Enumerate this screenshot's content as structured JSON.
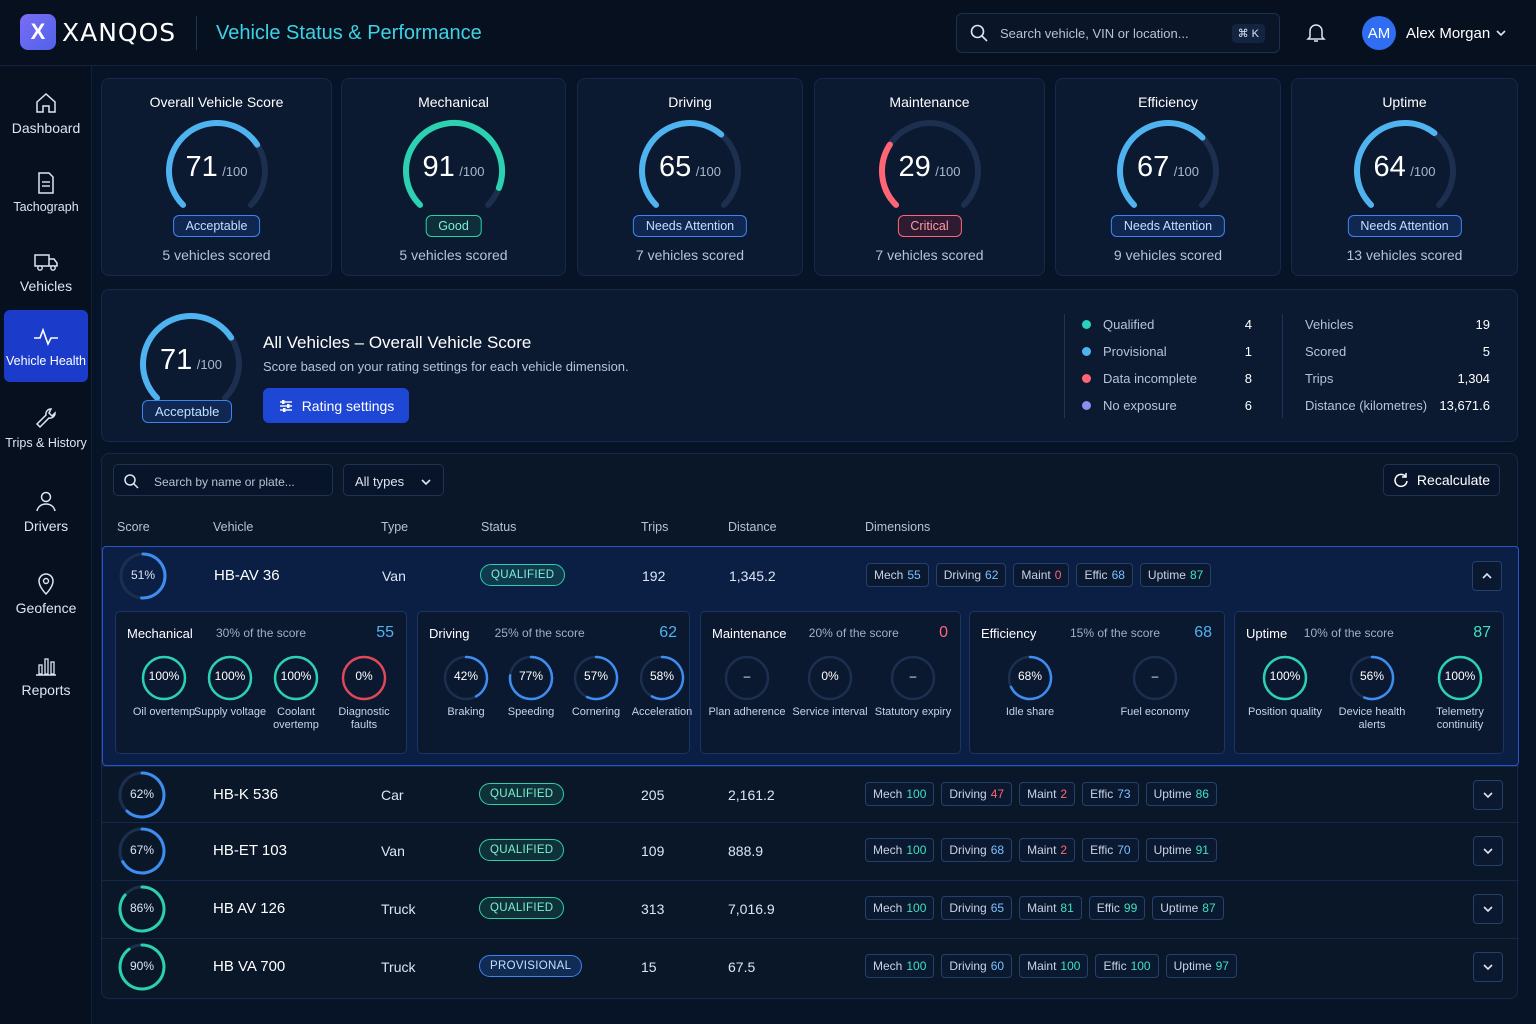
{
  "header": {
    "logo_letter": "X",
    "brand": "XANQOS",
    "title": "Vehicle Status & Performance",
    "search_placeholder": "Search vehicle, VIN or location...",
    "shortcut": "⌘ K",
    "user_initials": "AM",
    "user_name": "Alex Morgan"
  },
  "sidebar": {
    "items": [
      {
        "label": "Dashboard"
      },
      {
        "label": "Tachograph"
      },
      {
        "label": "Vehicles"
      },
      {
        "label": "Vehicle Health"
      },
      {
        "label": "Trips & History"
      },
      {
        "label": "Drivers"
      },
      {
        "label": "Geofence"
      },
      {
        "label": "Reports"
      }
    ]
  },
  "kpis": [
    {
      "title": "Overall Vehicle Score",
      "score": "71",
      "max": "/100",
      "status": "Acceptable",
      "sub": "5 vehicles scored",
      "value": 71
    },
    {
      "title": "Mechanical",
      "score": "91",
      "max": "/100",
      "status": "Good",
      "sub": "5 vehicles scored",
      "value": 91
    },
    {
      "title": "Driving",
      "score": "65",
      "max": "/100",
      "status": "Needs Attention",
      "sub": "7 vehicles scored",
      "value": 65
    },
    {
      "title": "Maintenance",
      "score": "29",
      "max": "/100",
      "status": "Critical",
      "sub": "7 vehicles scored",
      "value": 29
    },
    {
      "title": "Efficiency",
      "score": "67",
      "max": "/100",
      "status": "Needs Attention",
      "sub": "9 vehicles scored",
      "value": 67
    },
    {
      "title": "Uptime",
      "score": "64",
      "max": "/100",
      "status": "Needs Attention",
      "sub": "13 vehicles scored",
      "value": 64
    }
  ],
  "summary": {
    "score": "71",
    "max": "/100",
    "value": 71,
    "status": "Acceptable",
    "title": "All Vehicles – Overall Vehicle Score",
    "desc": "Score based on your rating settings for each vehicle dimension.",
    "button": "Rating settings",
    "legend": [
      {
        "label": "Qualified",
        "value": "4",
        "color": "#2bd1c0"
      },
      {
        "label": "Provisional",
        "value": "1",
        "color": "#4fb3f0"
      },
      {
        "label": "Data incomplete",
        "value": "8",
        "color": "#ff6574"
      },
      {
        "label": "No exposure",
        "value": "6",
        "color": "#8a8ff0"
      }
    ],
    "stats": [
      {
        "label": "Vehicles",
        "value": "19"
      },
      {
        "label": "Scored",
        "value": "5"
      },
      {
        "label": "Trips",
        "value": "1,304"
      },
      {
        "label": "Distance (kilometres)",
        "value": "13,671.6"
      }
    ]
  },
  "table": {
    "search_placeholder": "Search by name or plate...",
    "type_filter": "All types",
    "recalc": "Recalculate",
    "headers": {
      "score": "Score",
      "vehicle": "Vehicle",
      "type": "Type",
      "status": "Status",
      "trips": "Trips",
      "distance": "Distance",
      "dimensions": "Dimensions"
    },
    "rows": [
      {
        "score": "51%",
        "value": 51,
        "vehicle": "HB-AV 36",
        "type": "Van",
        "status": "QUALIFIED",
        "trips": "192",
        "distance": "1,345.2",
        "dims": [
          [
            "Mech",
            "55"
          ],
          [
            "Driving",
            "62"
          ],
          [
            "Maint",
            "0"
          ],
          [
            "Effic",
            "68"
          ],
          [
            "Uptime",
            "87"
          ]
        ]
      },
      {
        "score": "62%",
        "value": 62,
        "vehicle": "HB-K 536",
        "type": "Car",
        "status": "QUALIFIED",
        "trips": "205",
        "distance": "2,161.2",
        "dims": [
          [
            "Mech",
            "100"
          ],
          [
            "Driving",
            "47"
          ],
          [
            "Maint",
            "2"
          ],
          [
            "Effic",
            "73"
          ],
          [
            "Uptime",
            "86"
          ]
        ]
      },
      {
        "score": "67%",
        "value": 67,
        "vehicle": "HB-ET 103",
        "type": "Van",
        "status": "QUALIFIED",
        "trips": "109",
        "distance": "888.9",
        "dims": [
          [
            "Mech",
            "100"
          ],
          [
            "Driving",
            "68"
          ],
          [
            "Maint",
            "2"
          ],
          [
            "Effic",
            "70"
          ],
          [
            "Uptime",
            "91"
          ]
        ]
      },
      {
        "score": "86%",
        "value": 86,
        "vehicle": "HB AV 126",
        "type": "Truck",
        "status": "QUALIFIED",
        "trips": "313",
        "distance": "7,016.9",
        "dims": [
          [
            "Mech",
            "100"
          ],
          [
            "Driving",
            "65"
          ],
          [
            "Maint",
            "81"
          ],
          [
            "Effic",
            "99"
          ],
          [
            "Uptime",
            "87"
          ]
        ]
      },
      {
        "score": "90%",
        "value": 90,
        "vehicle": "HB VA 700",
        "type": "Truck",
        "status": "PROVISIONAL",
        "trips": "15",
        "distance": "67.5",
        "dims": [
          [
            "Mech",
            "100"
          ],
          [
            "Driving",
            "60"
          ],
          [
            "Maint",
            "100"
          ],
          [
            "Effic",
            "100"
          ],
          [
            "Uptime",
            "97"
          ]
        ]
      }
    ]
  },
  "details": [
    {
      "title": "Mechanical",
      "weight": "30% of the score",
      "score": "55",
      "metrics": [
        {
          "v": "100%",
          "p": 100,
          "l": "Oil overtemp"
        },
        {
          "v": "100%",
          "p": 100,
          "l": "Supply voltage"
        },
        {
          "v": "100%",
          "p": 100,
          "l": "Coolant overtemp"
        },
        {
          "v": "0%",
          "p": 0,
          "l": "Diagnostic faults"
        }
      ]
    },
    {
      "title": "Driving",
      "weight": "25% of the score",
      "score": "62",
      "metrics": [
        {
          "v": "42%",
          "p": 42,
          "l": "Braking"
        },
        {
          "v": "77%",
          "p": 77,
          "l": "Speeding"
        },
        {
          "v": "57%",
          "p": 57,
          "l": "Cornering"
        },
        {
          "v": "58%",
          "p": 58,
          "l": "Acceleration"
        }
      ]
    },
    {
      "title": "Maintenance",
      "weight": "20% of the score",
      "score": "0",
      "metrics": [
        {
          "v": "–",
          "p": 0,
          "l": "Plan adherence"
        },
        {
          "v": "0%",
          "p": 0,
          "l": "Service interval"
        },
        {
          "v": "–",
          "p": 0,
          "l": "Statutory expiry"
        }
      ]
    },
    {
      "title": "Efficiency",
      "weight": "15% of the score",
      "score": "68",
      "metrics": [
        {
          "v": "68%",
          "p": 68,
          "l": "Idle share"
        },
        {
          "v": "–",
          "p": 0,
          "l": "Fuel economy"
        }
      ]
    },
    {
      "title": "Uptime",
      "weight": "10% of the score",
      "score": "87",
      "metrics": [
        {
          "v": "100%",
          "p": 100,
          "l": "Position quality"
        },
        {
          "v": "56%",
          "p": 56,
          "l": "Device health alerts"
        },
        {
          "v": "100%",
          "p": 100,
          "l": "Telemetry continuity"
        }
      ]
    }
  ]
}
